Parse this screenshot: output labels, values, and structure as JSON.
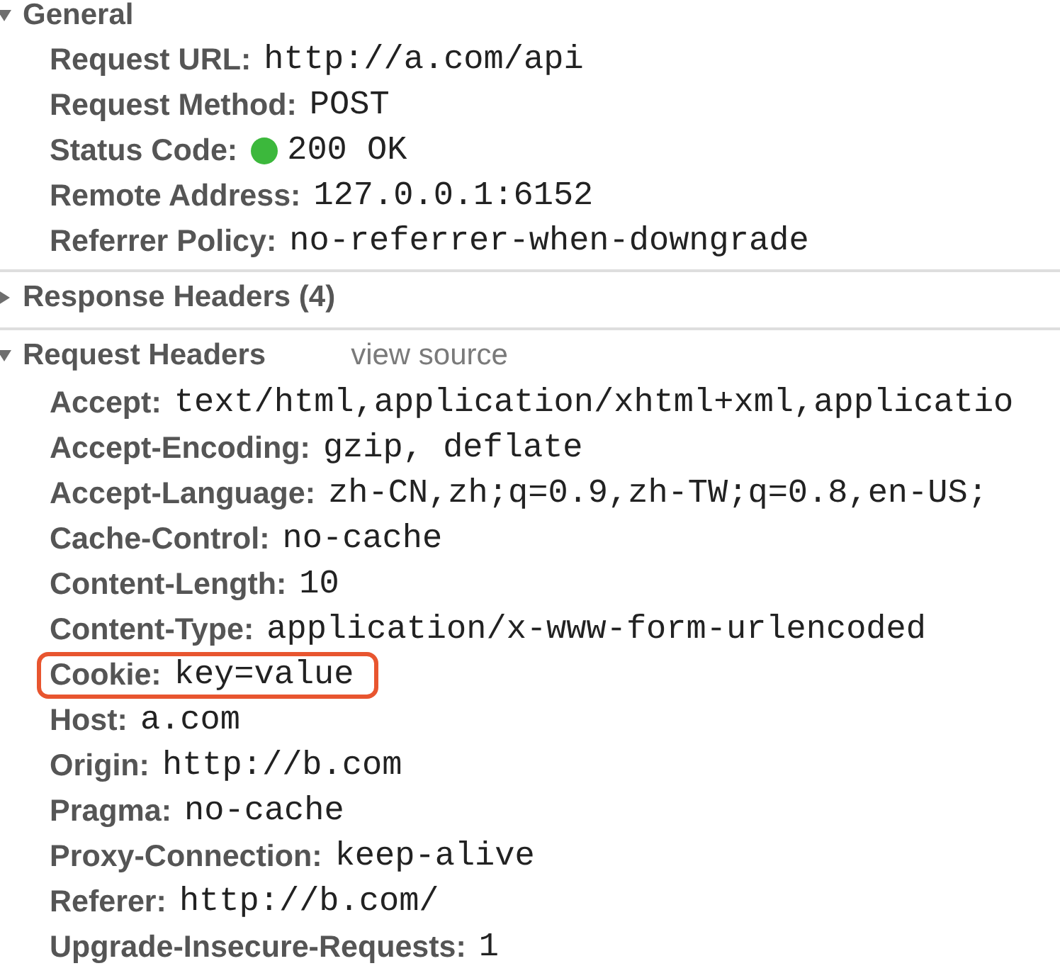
{
  "sections": [
    {
      "title": "General",
      "expanded": true,
      "items": [
        {
          "label": "Request URL:",
          "value": "http://a.com/api",
          "highlighted": false
        },
        {
          "label": "Request Method:",
          "value": "POST",
          "highlighted": false
        },
        {
          "label": "Status Code:",
          "value": "200 OK",
          "color": "#3cb83c",
          "highlighted": false
        },
        {
          "label": "Remote Address:",
          "value": "127.0.0.1:6152",
          "highlighted": false
        },
        {
          "label": "Referrer Policy:",
          "value": "no-referrer-when-downgrade",
          "highlighted": false
        }
      ]
    },
    {
      "title": "Response Headers (4)",
      "expanded": false
    },
    {
      "title": "Request Headers",
      "expanded": true,
      "link": "view source",
      "items": [
        {
          "label": "Accept:",
          "value": "text/html,application/xhtml+xml,applicatio",
          "highlighted": false
        },
        {
          "label": "Accept-Encoding:",
          "value": "gzip, deflate",
          "highlighted": false
        },
        {
          "label": "Accept-Language:",
          "value": "zh-CN,zh;q=0.9,zh-TW;q=0.8,en-US;",
          "highlighted": false
        },
        {
          "label": "Cache-Control:",
          "value": "no-cache",
          "highlighted": false
        },
        {
          "label": "Content-Length:",
          "value": "10",
          "highlighted": false
        },
        {
          "label": "Content-Type:",
          "value": "application/x-www-form-urlencoded",
          "highlighted": false
        },
        {
          "label": "Cookie:",
          "value": "key=value",
          "highlighted": true
        },
        {
          "label": "Host:",
          "value": "a.com",
          "highlighted": false
        },
        {
          "label": "Origin:",
          "value": "http://b.com",
          "highlighted": false
        },
        {
          "label": "Pragma:",
          "value": "no-cache",
          "highlighted": false
        },
        {
          "label": "Proxy-Connection:",
          "value": "keep-alive",
          "highlighted": false
        },
        {
          "label": "Referer:",
          "value": "http://b.com/",
          "highlighted": false
        },
        {
          "label": "Upgrade-Insecure-Requests:",
          "value": "1",
          "highlighted": false
        }
      ]
    }
  ]
}
